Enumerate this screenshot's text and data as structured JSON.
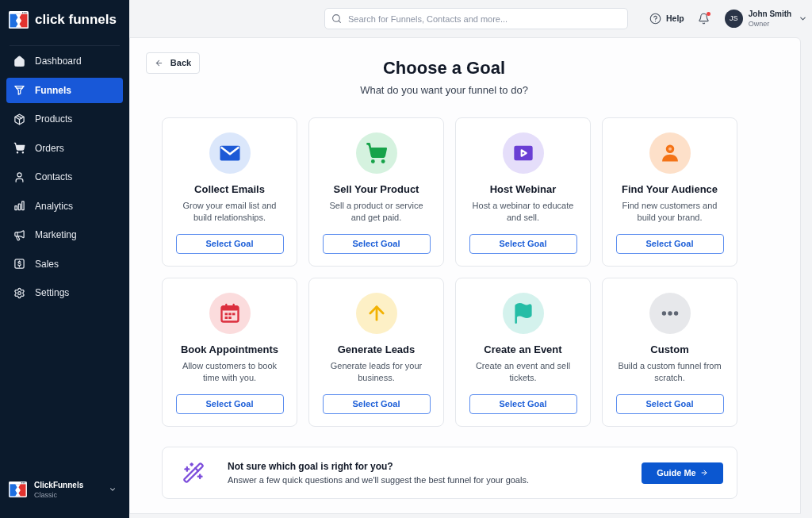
{
  "sidebar": {
    "brand": "click funnels",
    "items": [
      {
        "label": "Dashboard",
        "selected": false
      },
      {
        "label": "Funnels",
        "selected": true
      },
      {
        "label": "Products",
        "selected": false
      },
      {
        "label": "Orders",
        "selected": false
      },
      {
        "label": "Contacts",
        "selected": false
      },
      {
        "label": "Analytics",
        "selected": false
      },
      {
        "label": "Marketing",
        "selected": false
      },
      {
        "label": "Sales",
        "selected": false
      },
      {
        "label": "Settings",
        "selected": false
      }
    ],
    "account": {
      "name": "ClickFunnels",
      "plan": "Classic"
    }
  },
  "header": {
    "search": {
      "placeholder": "Search for Funnels, Contacts and more..."
    },
    "help": "Help",
    "notifications": {
      "unread": true
    },
    "user": {
      "initials": "JS",
      "name": "John Smith",
      "role": "Owner"
    }
  },
  "page": {
    "back": "Back",
    "title": "Choose a Goal",
    "subtitle": "What do you want your funnel to do?",
    "goals": [
      {
        "title": "Collect Emails",
        "description": "Grow your email list and build relationships.",
        "button": "Select Goal"
      },
      {
        "title": "Sell Your Product",
        "description": "Sell a product or service and get paid.",
        "button": "Select Goal"
      },
      {
        "title": "Host Webinar",
        "description": "Host a webinar to educate and sell.",
        "button": "Select Goal"
      },
      {
        "title": "Find Your Audience",
        "description": "Find new customers and build your brand.",
        "button": "Select Goal"
      },
      {
        "title": "Book Appointments",
        "description": "Allow customers to book time with you.",
        "button": "Select Goal"
      },
      {
        "title": "Generate Leads",
        "description": "Generate leads for your business.",
        "button": "Select Goal"
      },
      {
        "title": "Create an Event",
        "description": "Create an event and sell tickets.",
        "button": "Select Goal"
      },
      {
        "title": "Custom",
        "description": "Build a custom funnel from scratch.",
        "button": "Select Goal"
      }
    ],
    "prompt": {
      "title": "Not sure which goal is right for you?",
      "text": "Answer a few quick questions and we'll suggest the best funnel for your goals.",
      "button": "Guide Me"
    }
  }
}
